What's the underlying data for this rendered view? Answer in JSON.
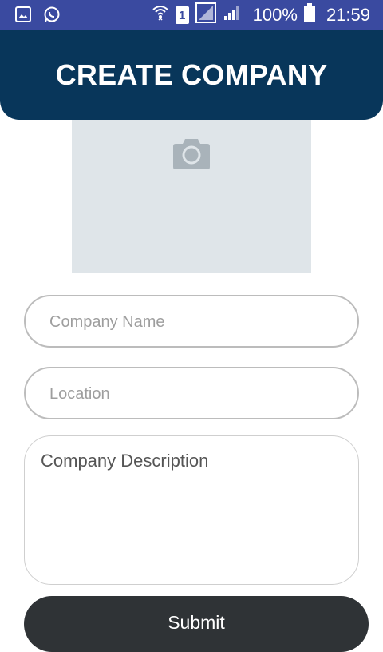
{
  "status_bar": {
    "battery": "100%",
    "time": "21:59",
    "sim_slot": "1",
    "icons": [
      "gallery-icon",
      "whatsapp-icon",
      "wifi-icon",
      "sim-icon",
      "no-signal-icon",
      "signal-icon",
      "battery-icon"
    ]
  },
  "header": {
    "title": "CREATE COMPANY"
  },
  "image_picker": {
    "icon": "camera-icon"
  },
  "form": {
    "company_name_placeholder": "Company Name",
    "location_placeholder": "Location",
    "description_placeholder": "Company Description",
    "submit_label": "Submit"
  },
  "colors": {
    "status_bar": "#3a4aa0",
    "header": "#08365a",
    "image_bg": "#dfe5e9",
    "submit": "#2f3336"
  }
}
